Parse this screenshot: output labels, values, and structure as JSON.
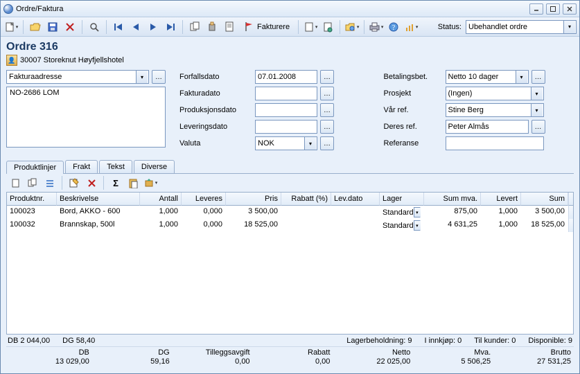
{
  "window": {
    "title": "Ordre/Faktura"
  },
  "toolbar": {
    "fakturere": "Fakturere",
    "status_label": "Status:",
    "status_value": "Ubehandlet ordre"
  },
  "order": {
    "title": "Ordre 316",
    "customer": "30007 Storeknut Høyfjellshotel"
  },
  "address": {
    "type": "Fakturaadresse",
    "body": "NO-2686 LOM"
  },
  "mid_fields": {
    "forfallsdato": {
      "label": "Forfallsdato",
      "value": "07.01.2008"
    },
    "fakturadato": {
      "label": "Fakturadato",
      "value": ""
    },
    "produksjonsdato": {
      "label": "Produksjonsdato",
      "value": ""
    },
    "leveringsdato": {
      "label": "Leveringsdato",
      "value": ""
    },
    "valuta": {
      "label": "Valuta",
      "value": "NOK"
    }
  },
  "right_fields": {
    "betalingsbet": {
      "label": "Betalingsbet.",
      "value": "Netto 10 dager"
    },
    "prosjekt": {
      "label": "Prosjekt",
      "value": "(Ingen)"
    },
    "var_ref": {
      "label": "Vår ref.",
      "value": "Stine Berg"
    },
    "deres_ref": {
      "label": "Deres ref.",
      "value": "Peter Almås"
    },
    "referanse": {
      "label": "Referanse",
      "value": ""
    }
  },
  "tabs": [
    "Produktlinjer",
    "Frakt",
    "Tekst",
    "Diverse"
  ],
  "grid": {
    "headers": [
      "Produktnr.",
      "Beskrivelse",
      "Antall",
      "Leveres",
      "Pris",
      "Rabatt (%)",
      "Lev.dato",
      "Lager",
      "Sum mva.",
      "Levert",
      "Sum"
    ],
    "rows": [
      {
        "produktnr": "100023",
        "beskrivelse": "Bord, AKKO - 600",
        "antall": "1,000",
        "leveres": "0,000",
        "pris": "3 500,00",
        "rabatt": "",
        "levdato": "",
        "lager": "Standard",
        "summva": "875,00",
        "levert": "1,000",
        "sum": "3 500,00"
      },
      {
        "produktnr": "100032",
        "beskrivelse": "Brannskap, 500l",
        "antall": "1,000",
        "leveres": "0,000",
        "pris": "18 525,00",
        "rabatt": "",
        "levdato": "",
        "lager": "Standard",
        "summva": "4 631,25",
        "levert": "1,000",
        "sum": "18 525,00"
      }
    ]
  },
  "statusline": {
    "db": "DB   2 044,00",
    "dg": "DG   58,40",
    "lager": "Lagerbeholdning: 9",
    "innkjop": "I innkjøp: 0",
    "tilkunder": "Til kunder: 0",
    "disponible": "Disponible: 9"
  },
  "totals": {
    "db": {
      "label": "DB",
      "value": "13 029,00"
    },
    "dg": {
      "label": "DG",
      "value": "59,16"
    },
    "tilleggsavgift": {
      "label": "Tilleggsavgift",
      "value": "0,00"
    },
    "rabatt": {
      "label": "Rabatt",
      "value": "0,00"
    },
    "netto": {
      "label": "Netto",
      "value": "22 025,00"
    },
    "mva": {
      "label": "Mva.",
      "value": "5 506,25"
    },
    "brutto": {
      "label": "Brutto",
      "value": "27 531,25"
    }
  }
}
